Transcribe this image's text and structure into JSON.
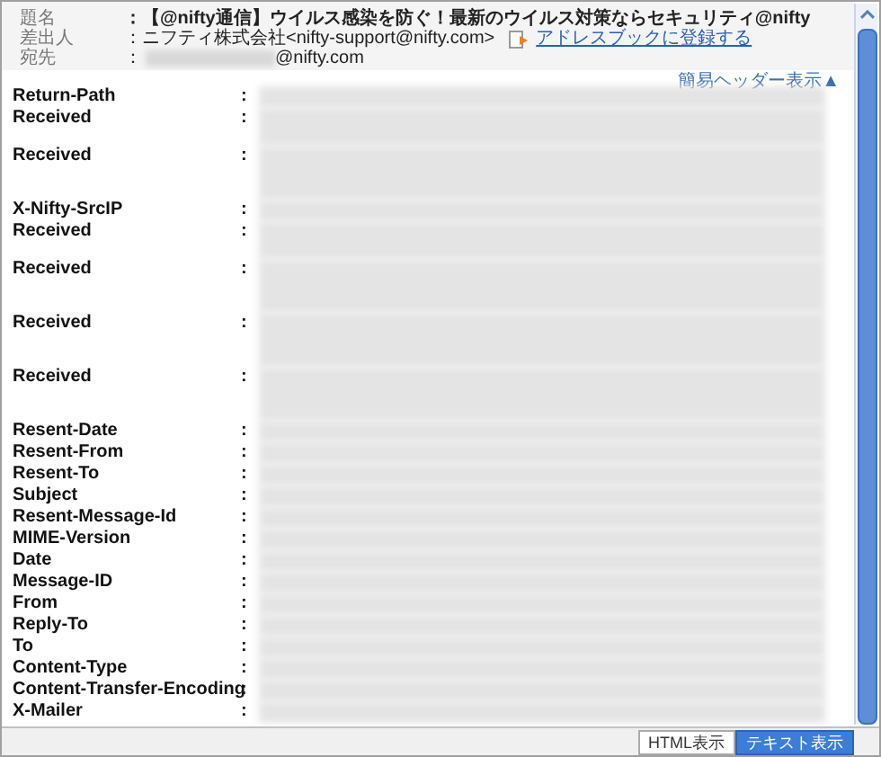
{
  "header": [
    {
      "label": "題名",
      "value": "：【@nifty通信】ウイルス感染を防ぐ！最新のウイルス対策ならセキュリティ@nifty",
      "kind": "subject"
    },
    {
      "label": "差出人",
      "value": "：ニフティ株式会社<nifty-support@nifty.com>",
      "link": "アドレスブックに登録する",
      "kind": "sender"
    },
    {
      "label": "宛先",
      "prefix": "：",
      "value": "@nifty.com",
      "kind": "recipient"
    }
  ],
  "toggle_link": "簡易ヘッダー表示▲",
  "fields": [
    {
      "name": "Return-Path",
      "kind": "single"
    },
    {
      "name": "Received",
      "kind": "double"
    },
    {
      "name": "Received",
      "kind": "triple"
    },
    {
      "name": "X-Nifty-SrcIP",
      "kind": "single"
    },
    {
      "name": "Received",
      "kind": "double"
    },
    {
      "name": "Received",
      "kind": "triple"
    },
    {
      "name": "Received",
      "kind": "triple"
    },
    {
      "name": "Received",
      "kind": "triple"
    },
    {
      "name": "Resent-Date",
      "kind": "single"
    },
    {
      "name": "Resent-From",
      "kind": "single"
    },
    {
      "name": "Resent-To",
      "kind": "single"
    },
    {
      "name": "Subject",
      "kind": "single"
    },
    {
      "name": "Resent-Message-Id",
      "kind": "single"
    },
    {
      "name": "MIME-Version",
      "kind": "single"
    },
    {
      "name": "Date",
      "kind": "single"
    },
    {
      "name": "Message-ID",
      "kind": "single"
    },
    {
      "name": "From",
      "kind": "single"
    },
    {
      "name": "Reply-To",
      "kind": "single"
    },
    {
      "name": "To",
      "kind": "single"
    },
    {
      "name": "Content-Type",
      "kind": "single"
    },
    {
      "name": "Content-Transfer-Encoding",
      "kind": "single"
    },
    {
      "name": "X-Mailer",
      "kind": "single"
    }
  ],
  "colon": ":",
  "view_tabs": [
    {
      "label": "HTML表示",
      "selected": false
    },
    {
      "label": "テキスト表示",
      "selected": true
    }
  ]
}
